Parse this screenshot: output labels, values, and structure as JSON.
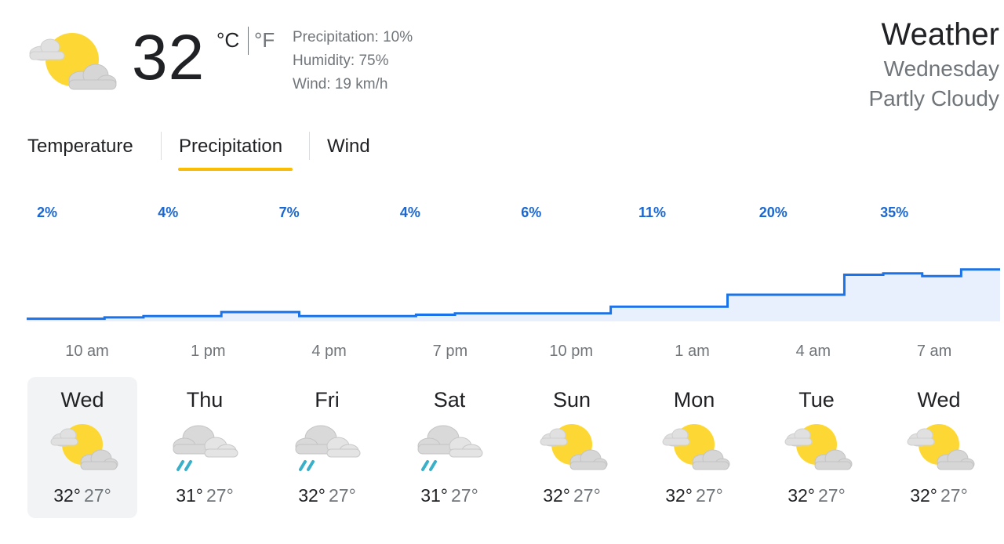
{
  "current": {
    "temp": "32",
    "unit_c": "°C",
    "unit_f": "°F",
    "precipitation": "Precipitation: 10%",
    "humidity": "Humidity: 75%",
    "wind": "Wind: 19 km/h",
    "icon": "partly-cloudy-icon"
  },
  "header": {
    "title": "Weather",
    "day": "Wednesday",
    "condition": "Partly Cloudy"
  },
  "tabs": [
    {
      "label": "Temperature",
      "active": false
    },
    {
      "label": "Precipitation",
      "active": true
    },
    {
      "label": "Wind",
      "active": false
    }
  ],
  "colors": {
    "accent": "#fbbc04",
    "chart_line": "#1a73e8",
    "chart_fill": "#e8f0fe",
    "chart_label": "#1967d2"
  },
  "chart_data": {
    "type": "area",
    "x": [
      "10 am",
      "",
      "",
      "1 pm",
      "",
      "",
      "4 pm",
      "",
      "",
      "7 pm",
      "",
      "",
      "10 pm",
      "",
      "",
      "1 am",
      "",
      "",
      "4 am",
      "",
      "",
      "7 am",
      "",
      ""
    ],
    "values": [
      2,
      2,
      3,
      4,
      4,
      7,
      7,
      4,
      4,
      4,
      5,
      6,
      6,
      6,
      6,
      11,
      11,
      11,
      20,
      20,
      20,
      35,
      36,
      34,
      39
    ],
    "value_labels": [
      "2%",
      "4%",
      "7%",
      "4%",
      "6%",
      "11%",
      "20%",
      "35%"
    ],
    "tick_labels": [
      "10 am",
      "1 pm",
      "4 pm",
      "7 pm",
      "10 pm",
      "1 am",
      "4 am",
      "7 am"
    ],
    "ylim": [
      0,
      100
    ]
  },
  "forecast": [
    {
      "day": "Wed",
      "icon": "partly-cloudy-icon",
      "hi": "32°",
      "lo": "27°"
    },
    {
      "day": "Thu",
      "icon": "rain-icon",
      "hi": "31°",
      "lo": "27°"
    },
    {
      "day": "Fri",
      "icon": "rain-icon",
      "hi": "32°",
      "lo": "27°"
    },
    {
      "day": "Sat",
      "icon": "rain-icon",
      "hi": "31°",
      "lo": "27°"
    },
    {
      "day": "Sun",
      "icon": "partly-cloudy-icon",
      "hi": "32°",
      "lo": "27°"
    },
    {
      "day": "Mon",
      "icon": "partly-cloudy-icon",
      "hi": "32°",
      "lo": "27°"
    },
    {
      "day": "Tue",
      "icon": "partly-cloudy-icon",
      "hi": "32°",
      "lo": "27°"
    },
    {
      "day": "Wed",
      "icon": "partly-cloudy-icon",
      "hi": "32°",
      "lo": "27°"
    }
  ]
}
